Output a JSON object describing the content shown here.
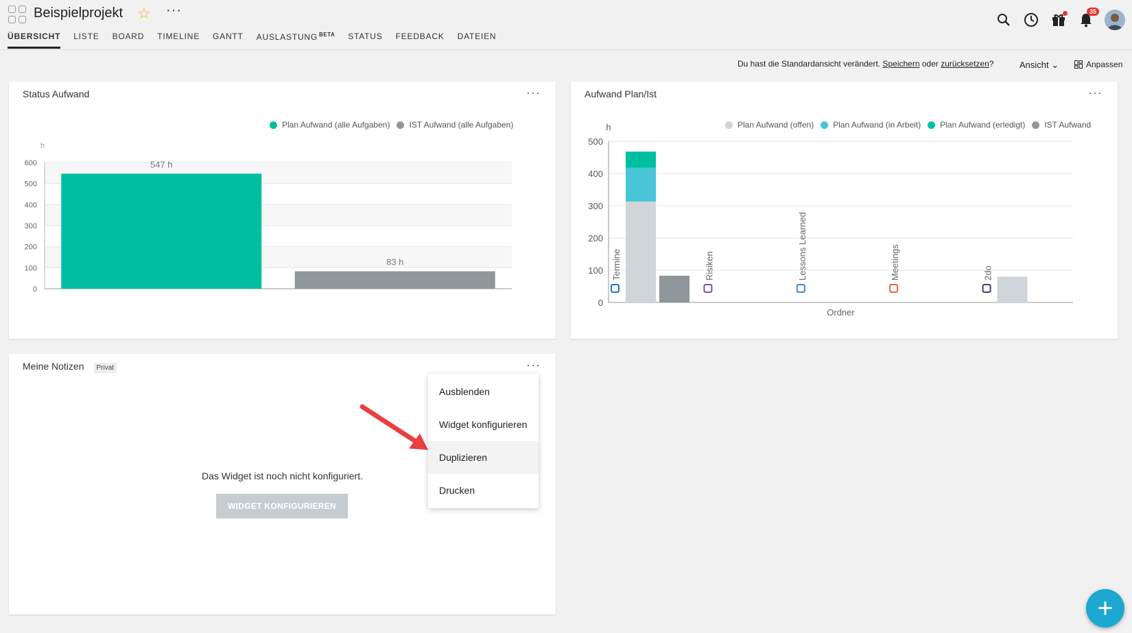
{
  "header": {
    "project_title": "Beispielprojekt",
    "notifications_count": "35",
    "tabs": [
      {
        "label": "ÜBERSICHT",
        "active": true
      },
      {
        "label": "LISTE"
      },
      {
        "label": "BOARD"
      },
      {
        "label": "TIMELINE"
      },
      {
        "label": "GANTT"
      },
      {
        "label": "AUSLASTUNG",
        "sup": "BETA"
      },
      {
        "label": "STATUS"
      },
      {
        "label": "FEEDBACK"
      },
      {
        "label": "DATEIEN"
      }
    ],
    "icons": [
      "apps-grid-icon",
      "star-icon",
      "more-horizontal-icon",
      "search-icon",
      "clock-icon",
      "gift-icon",
      "bell-icon",
      "user-avatar"
    ]
  },
  "notice": {
    "text_before": "Du hast die Standardansicht verändert. ",
    "save_link": "Speichern",
    "middle": " oder ",
    "reset_link": "zurücksetzen",
    "after": "?"
  },
  "toolbar": {
    "view_label": "Ansicht",
    "customize_label": "Anpassen"
  },
  "widgets": {
    "status": {
      "title": "Status Aufwand",
      "legend": [
        "Plan Aufwand (alle Aufgaben)",
        "IST Aufwand (alle Aufgaben)"
      ]
    },
    "plan_ist": {
      "title": "Aufwand Plan/Ist",
      "legend": [
        "Plan Aufwand (offen)",
        "Plan Aufwand (in Arbeit)",
        "Plan Aufwand (erledigt)",
        "IST Aufwand"
      ]
    },
    "notes": {
      "title": "Meine Notizen",
      "tag": "Privat",
      "empty_message": "Das Widget ist noch nicht konfiguriert.",
      "configure_button": "WIDGET KONFIGURIEREN"
    }
  },
  "context_menu": {
    "items": [
      "Ausblenden",
      "Widget konfigurieren",
      "Duplizieren",
      "Drucken"
    ],
    "hovered": "Duplizieren"
  },
  "colors": {
    "teal": "#00bfa0",
    "gray": "#8f979b",
    "light": "#cfd5d9",
    "cyan": "#48c5d6",
    "fab": "#1ca8d0"
  },
  "chart_data": [
    {
      "type": "bar",
      "title": "Status Aufwand",
      "ylabel": "h",
      "ylim": [
        0,
        600
      ],
      "yticks": [
        0,
        100,
        200,
        300,
        400,
        500,
        600
      ],
      "series": [
        {
          "name": "Plan Aufwand (alle Aufgaben)",
          "value": 547,
          "label": "547 h",
          "color": "#00bfa0"
        },
        {
          "name": "IST Aufwand (alle Aufgaben)",
          "value": 83,
          "label": "83 h",
          "color": "#8f979b"
        }
      ],
      "grid": true
    },
    {
      "type": "bar",
      "stacked": true,
      "title": "Aufwand Plan/Ist",
      "ylabel": "h",
      "xlabel": "Ordner",
      "ylim": [
        0,
        500
      ],
      "yticks": [
        0,
        100,
        200,
        300,
        400,
        500
      ],
      "categories": [
        "Termine",
        "Risiken",
        "Lessons Learned",
        "Meetings",
        "2do"
      ],
      "series": [
        {
          "name": "Plan Aufwand (offen)",
          "color": "#cfd5d9",
          "values": [
            313,
            0,
            0,
            0,
            80
          ]
        },
        {
          "name": "Plan Aufwand (in Arbeit)",
          "color": "#48c5d6",
          "values": [
            105,
            0,
            0,
            0,
            0
          ]
        },
        {
          "name": "Plan Aufwand (erledigt)",
          "color": "#00bfa0",
          "values": [
            50,
            0,
            0,
            0,
            0
          ]
        },
        {
          "name": "IST Aufwand",
          "color": "#8f979b",
          "values": [
            83,
            0,
            0,
            0,
            0
          ]
        }
      ],
      "grid": true
    }
  ]
}
